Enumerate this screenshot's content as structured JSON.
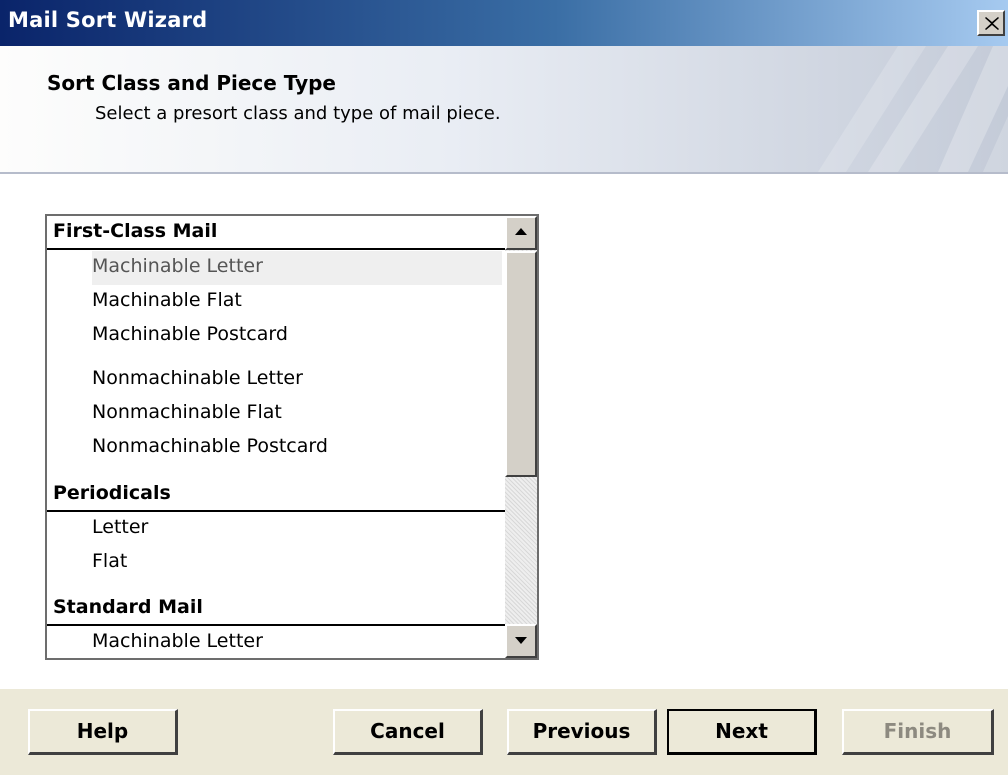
{
  "window": {
    "title": "Mail Sort Wizard"
  },
  "header": {
    "title": "Sort Class and Piece Type",
    "subtitle": "Select a presort class and type of mail piece."
  },
  "list": {
    "groups": [
      {
        "label": "First-Class Mail",
        "items": [
          "Machinable Letter",
          "Machinable Flat",
          "Machinable Postcard",
          "Nonmachinable Letter",
          "Nonmachinable Flat",
          "Nonmachinable Postcard"
        ]
      },
      {
        "label": "Periodicals",
        "items": [
          "Letter",
          "Flat"
        ]
      },
      {
        "label": "Standard Mail",
        "items": [
          "Machinable Letter"
        ]
      }
    ],
    "disabled_item": "Machinable Letter"
  },
  "buttons": {
    "help": "Help",
    "cancel": "Cancel",
    "previous": "Previous",
    "next": "Next",
    "finish": "Finish"
  }
}
